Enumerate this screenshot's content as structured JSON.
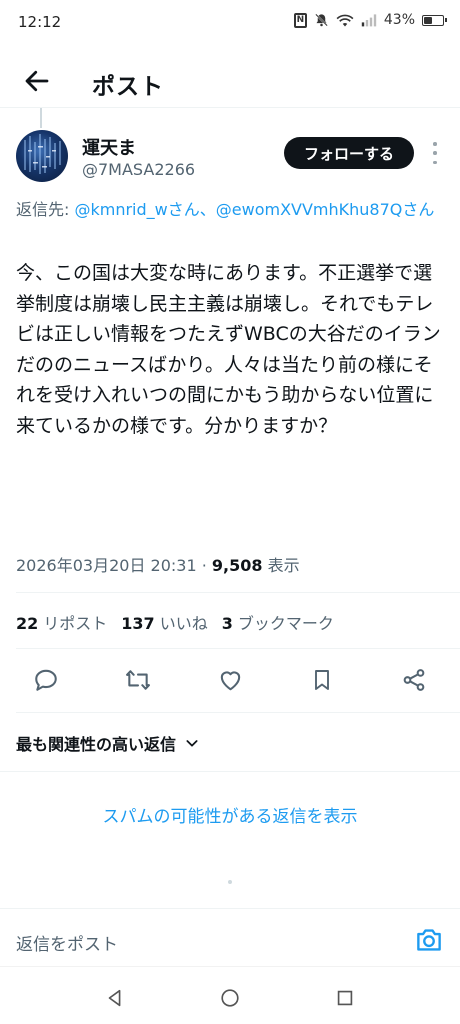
{
  "status_bar": {
    "time": "12:12",
    "nfc": "N",
    "battery_text": "43%",
    "battery_level": 0.43
  },
  "header": {
    "title": "ポスト"
  },
  "tweet": {
    "author_name": "運天ま",
    "author_handle": "@7MASA2266",
    "follow_label": "フォローする",
    "reply_prefix": "返信先: ",
    "reply_mention_1": "@kmnrid_w",
    "reply_sep": "さん、",
    "reply_mention_2": "@ewomXVVmhKhu87Q",
    "reply_suffix": "さん",
    "text": "今、この国は大変な時にあります。不正選挙で選挙制度は崩壊し民主主義は崩壊し。それでもテレビは正しい情報をつたえずWBCの大谷だのイランだののニュースばかり。人々は当たり前の様にそれを受け入れいつの間にかもう助からない位置に来ているかの様です。分かりますか？",
    "datetime": "2026年03月20日 20:31",
    "separator": " · ",
    "views_count": "9,508",
    "views_label": " 表示"
  },
  "stats": {
    "reposts_count": "22",
    "reposts_label": "リポスト",
    "likes_count": "137",
    "likes_label": "いいね",
    "bookmarks_count": "3",
    "bookmarks_label": "ブックマーク"
  },
  "actions": [
    "reply-icon",
    "repost-icon",
    "like-icon",
    "bookmark-icon",
    "share-icon"
  ],
  "replies": {
    "sort_label": "最も関連性の高い返信",
    "spam_link": "スパムの可能性がある返信を表示"
  },
  "reply_bar": {
    "placeholder": "返信をポスト"
  },
  "colors": {
    "accent": "#1d9bf0",
    "text": "#0f1419",
    "secondary": "#536471"
  }
}
